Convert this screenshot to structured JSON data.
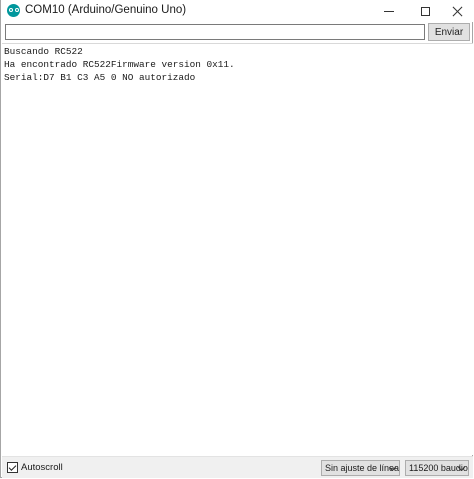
{
  "window": {
    "title": "COM10 (Arduino/Genuino Uno)",
    "app_icon": "arduino-logo-icon",
    "controls": {
      "minimize": "minimize-icon",
      "maximize": "maximize-icon",
      "close": "close-icon"
    },
    "accent_color": "#00979c"
  },
  "send": {
    "input_value": "",
    "button_label": "Enviar"
  },
  "output": {
    "lines": [
      "Buscando RC522",
      "Ha encontrado RC522Firmware version 0x11.",
      "Serial:D7 B1 C3 A5 0 NO autorizado"
    ]
  },
  "footer": {
    "autoscroll_label": "Autoscroll",
    "autoscroll_checked": true,
    "line_ending_selected": "Sin ajuste de línea",
    "baud_selected": "115200 baudio"
  }
}
